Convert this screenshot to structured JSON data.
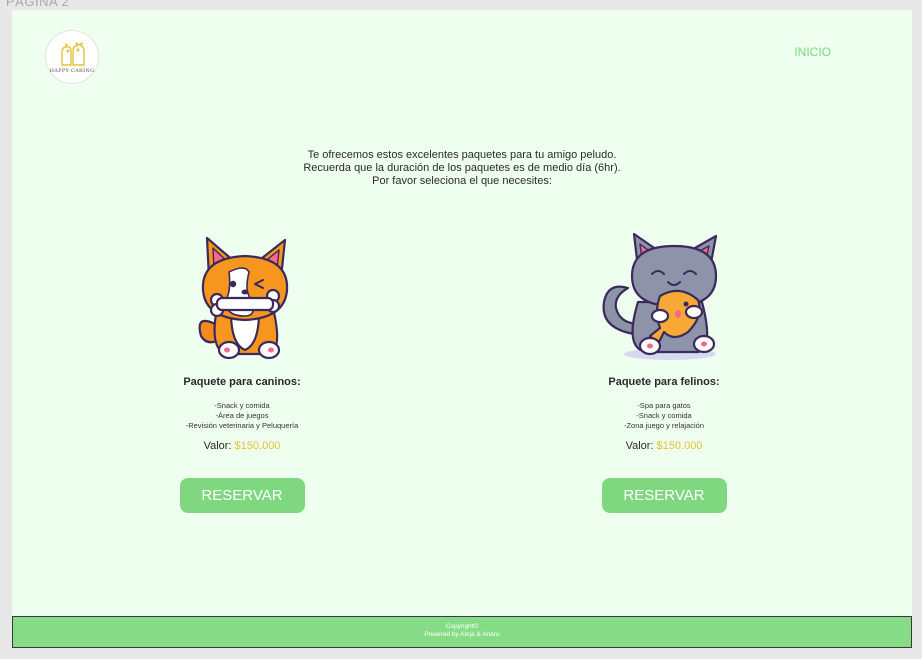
{
  "frame": {
    "label": "PÁGINA 2"
  },
  "logo": {
    "text": "HAPPY CARING"
  },
  "nav": {
    "home_label": "INICIO"
  },
  "intro": {
    "line1": "Te ofrecemos estos excelentes paquetes para tu  amigo peludo.",
    "line2": "Recuerda que la duración de los paquetes es de medio día (6hr).",
    "line3": "Por favor seleciona el que necesites:"
  },
  "packages": [
    {
      "title": "Paquete para caninos:",
      "items": [
        "-Snack y comida",
        "-Área de juegos",
        "-Revisión veterinaria y Peluquería"
      ],
      "price_label": "Valor:",
      "price": "$150.000",
      "button": "RESERVAR"
    },
    {
      "title": "Paquete para felinos:",
      "items": [
        "-Spa para gatos",
        "-Snack y comida",
        "-Zona juego y relajación"
      ],
      "price_label": "Valor:",
      "price": "$150.000",
      "button": "RESERVAR"
    }
  ],
  "footer": {
    "line1": "Copyright©",
    "line2": "Powered by Aleja & Anaru"
  },
  "colors": {
    "page_bg": "#efffef",
    "accent_green": "#7fd87f",
    "price_gold": "#e2c035"
  }
}
